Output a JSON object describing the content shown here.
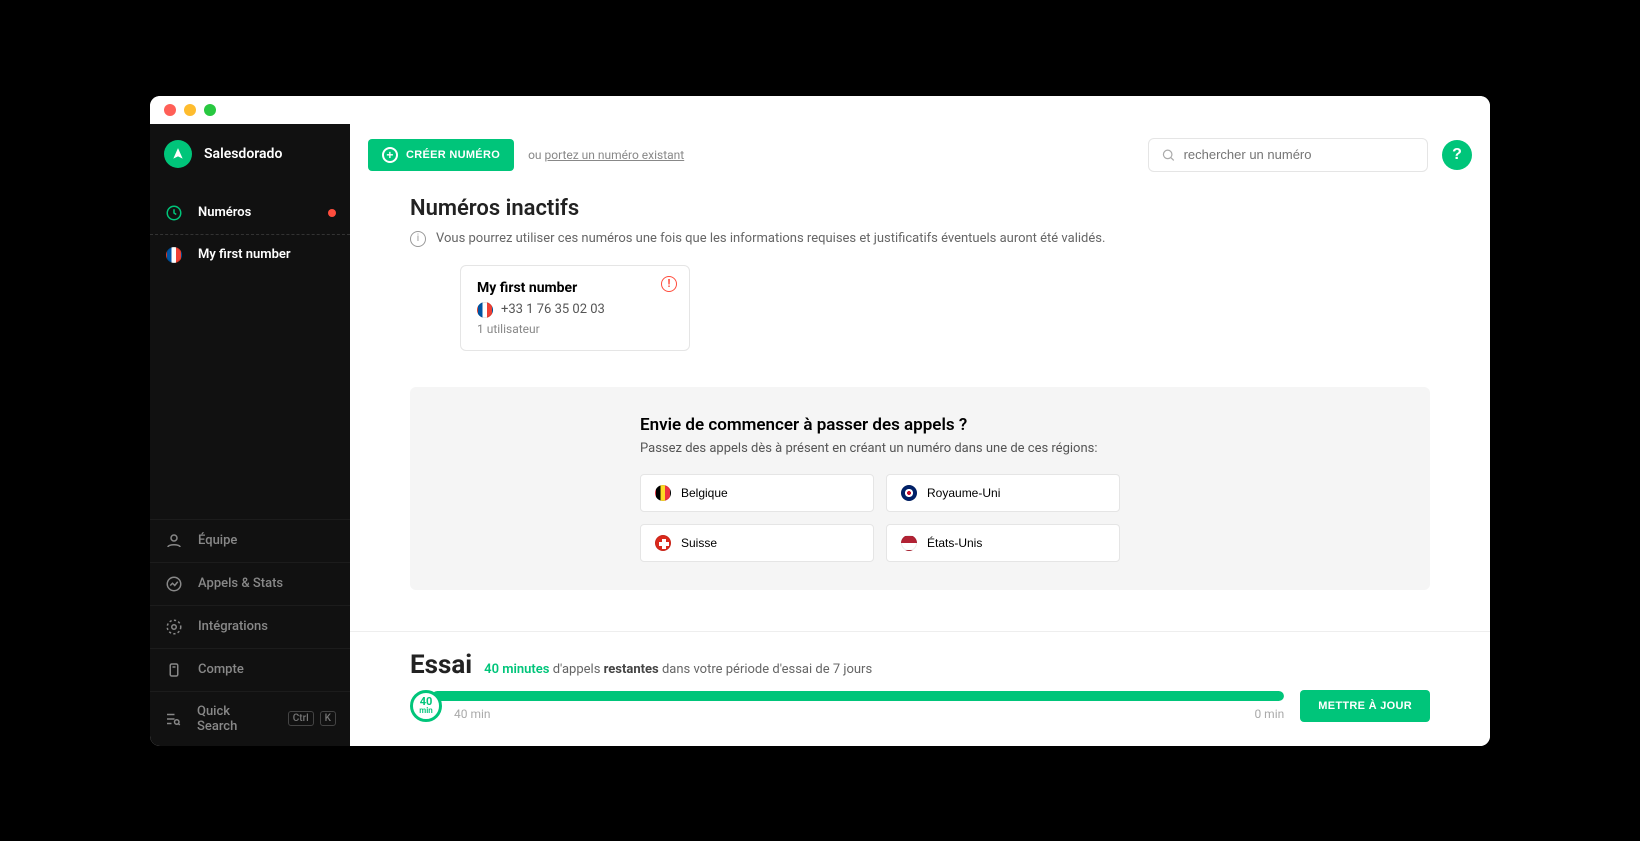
{
  "brand": {
    "name": "Salesdorado"
  },
  "sidebar": {
    "numeros": "Numéros",
    "first_number": "My first number",
    "equipe": "Équipe",
    "appels": "Appels & Stats",
    "integrations": "Intégrations",
    "compte": "Compte",
    "quick_search": "Quick Search",
    "kbd1": "Ctrl",
    "kbd2": "K"
  },
  "topbar": {
    "create": "CRÉER NUMÉRO",
    "import_prefix": "ou ",
    "import_link": "portez un numéro existant",
    "search_placeholder": "rechercher un numéro",
    "help": "?"
  },
  "inactive": {
    "title": "Numéros inactifs",
    "subtitle": "Vous pourrez utiliser ces numéros une fois que les informations requises et justificatifs éventuels auront été validés.",
    "card": {
      "name": "My first number",
      "phone": "+33 1 76 35 02 03",
      "users": "1 utilisateur",
      "warn": "!"
    }
  },
  "promo": {
    "title": "Envie de commencer à passer des appels ?",
    "subtitle": "Passez des appels dès à présent en créant un numéro dans une de ces régions:",
    "regions": {
      "be": "Belgique",
      "uk": "Royaume-Uni",
      "ch": "Suisse",
      "us": "États-Unis"
    }
  },
  "trial": {
    "title": "Essai",
    "accent": "40 minutes",
    "mid": " d'appels ",
    "bold": "restantes",
    "rest": " dans votre période d'essai de 7 jours",
    "knob": "40",
    "knob_unit": "min",
    "left_label": "40 min",
    "right_label": "0 min",
    "upgrade": "METTRE À JOUR",
    "fill_percent": 100
  }
}
